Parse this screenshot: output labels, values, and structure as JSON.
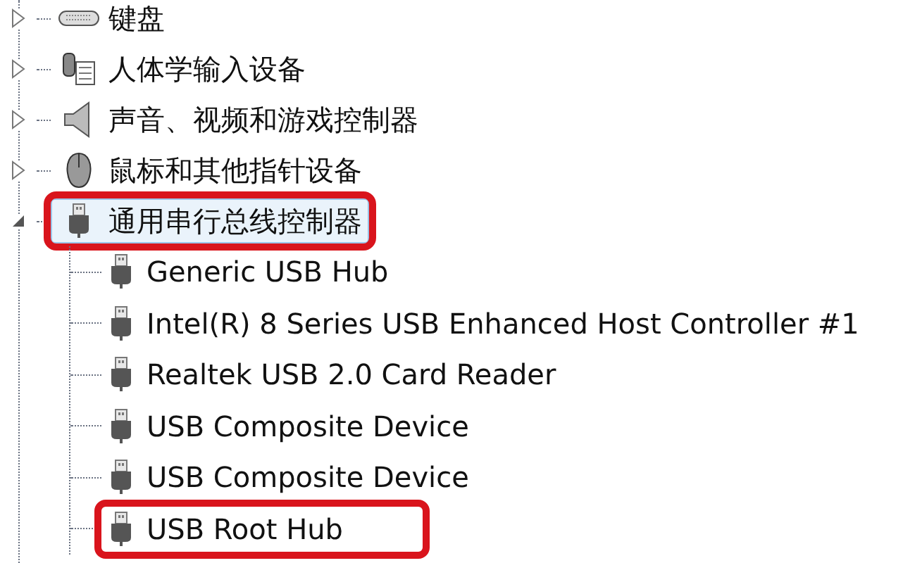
{
  "tree": [
    {
      "label": "键盘",
      "kind": "keyboard",
      "expanded": false,
      "selected": false,
      "highlighted": false
    },
    {
      "label": "人体学输入设备",
      "kind": "hid",
      "expanded": false,
      "selected": false,
      "highlighted": false
    },
    {
      "label": "声音、视频和游戏控制器",
      "kind": "speaker",
      "expanded": false,
      "selected": false,
      "highlighted": false
    },
    {
      "label": "鼠标和其他指针设备",
      "kind": "mouse",
      "expanded": false,
      "selected": false,
      "highlighted": false
    },
    {
      "label": "通用串行总线控制器",
      "kind": "usb",
      "expanded": true,
      "selected": true,
      "highlighted": true,
      "children": [
        {
          "label": "Generic USB Hub",
          "selected": false,
          "highlighted": false
        },
        {
          "label": "Intel(R) 8 Series USB Enhanced Host Controller #1",
          "selected": false,
          "highlighted": false
        },
        {
          "label": "Realtek USB 2.0 Card Reader",
          "selected": false,
          "highlighted": false
        },
        {
          "label": "USB Composite Device",
          "selected": false,
          "highlighted": false
        },
        {
          "label": "USB Composite Device",
          "selected": false,
          "highlighted": false
        },
        {
          "label": "USB Root Hub",
          "selected": false,
          "highlighted": true
        }
      ]
    }
  ]
}
